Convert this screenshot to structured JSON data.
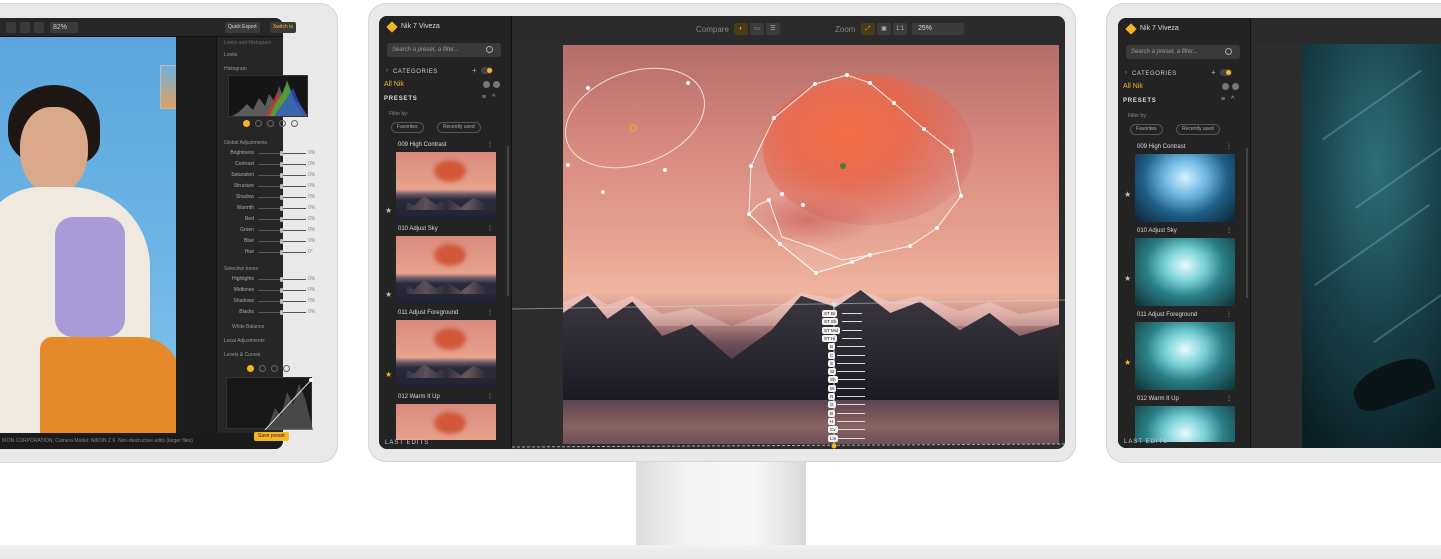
{
  "left_screen": {
    "zoom_value": "82%",
    "quick_export": "Quick Export",
    "switch_to": "Switch to",
    "panel_header": "Looks and Histogram",
    "looks_label": "Looks",
    "histogram_label": "Histogram",
    "global_adjustments_label": "Global Adjustments",
    "sliders_global": [
      {
        "label": "Brightness",
        "value": "0%"
      },
      {
        "label": "Contrast",
        "value": "0%"
      },
      {
        "label": "Saturation",
        "value": "0%"
      },
      {
        "label": "Structure",
        "value": "0%"
      },
      {
        "label": "Shadow",
        "value": "0%"
      },
      {
        "label": "Warmth",
        "value": "0%"
      },
      {
        "label": "Red",
        "value": "0%"
      },
      {
        "label": "Green",
        "value": "0%"
      },
      {
        "label": "Blue",
        "value": "0%"
      },
      {
        "label": "Hue",
        "value": "0°"
      }
    ],
    "selective_tones_label": "Selective tones",
    "sliders_tones": [
      {
        "label": "Highlights",
        "value": "0%"
      },
      {
        "label": "Midtones",
        "value": "0%"
      },
      {
        "label": "Shadows",
        "value": "0%"
      },
      {
        "label": "Blacks",
        "value": "0%"
      }
    ],
    "white_balance_label": "White Balance",
    "local_adjustments_label": "Local Adjustments",
    "levels_curves_label": "Levels & Curves",
    "camera_meta": "IKON CORPORATION, Camera Model: NIKON Z 6",
    "non_destructive": "Non-destructive edits (larger files)",
    "save_preset": "Save preset"
  },
  "center_screen": {
    "app_title": "Nik 7 Viveza",
    "search_placeholder": "Search a preset, a filter...",
    "categories_label": "CATEGORIES",
    "all_nik": "All Nik",
    "presets_label": "PRESETS",
    "filter_by": "Filter by:",
    "favorites": "Favorites",
    "recently_used": "Recently used",
    "presets": [
      {
        "name": "009 High Contrast",
        "favorite": false
      },
      {
        "name": "010 Adjust Sky",
        "favorite": false
      },
      {
        "name": "011 Adjust Foreground",
        "favorite": false
      },
      {
        "name": "012 Warm It Up",
        "favorite": true
      }
    ],
    "last_edits": "LAST EDITS",
    "compare_label": "Compare",
    "zoom_label": "Zoom",
    "zoom_ratio": "1:1",
    "zoom_value": "25%",
    "control_tags": [
      "ST Br",
      "ST Sh",
      "ST Mid",
      "ST Hi",
      "B",
      "C",
      "S",
      "St",
      "Sh",
      "W",
      "R",
      "G",
      "B",
      "H",
      "Cv",
      "Lm"
    ]
  },
  "right_screen": {
    "app_title": "Nik 7 Viveza",
    "search_placeholder": "Search a preset, a filter...",
    "categories_label": "CATEGORIES",
    "all_nik": "All Nik",
    "presets_label": "PRESETS",
    "filter_by": "Filter by:",
    "favorites": "Favorites",
    "recently_used": "Recently used",
    "presets": [
      {
        "name": "009 High Contrast",
        "favorite": false
      },
      {
        "name": "010 Adjust Sky",
        "favorite": true
      },
      {
        "name": "011 Adjust Foreground",
        "favorite": true
      },
      {
        "name": "012 Warm It Up",
        "favorite": true
      }
    ],
    "last_edits": "LAST EDITS"
  },
  "colors": {
    "accent": "#f5b623",
    "panel": "#232323",
    "frame": "#e9e9e9"
  },
  "icons": [
    "search-icon",
    "chevron-right-icon",
    "plus-icon",
    "toggle-icon",
    "list-icon",
    "chevron-up-icon",
    "star-icon",
    "more-icon",
    "compare-icon",
    "zoom-fit-icon",
    "pin-icon",
    "reset-icon"
  ]
}
